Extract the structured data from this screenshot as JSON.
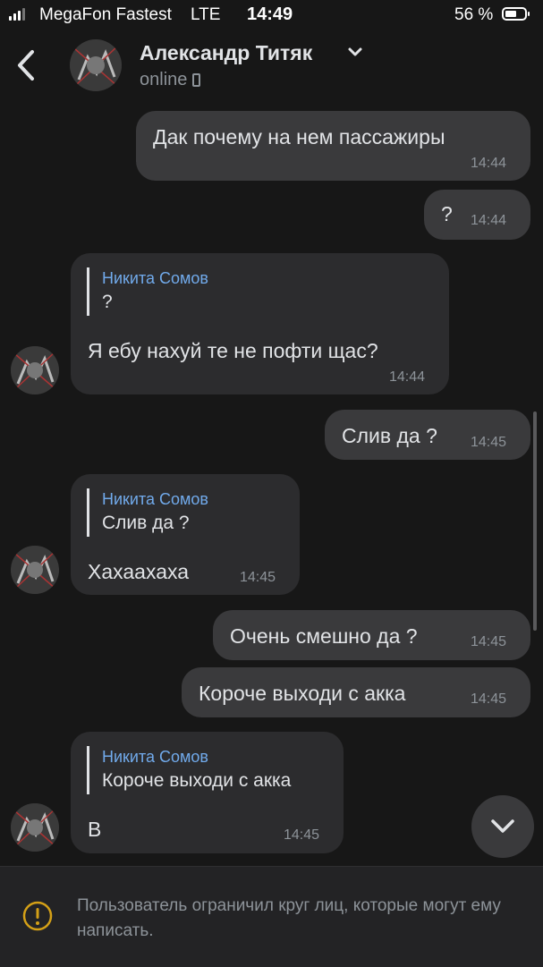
{
  "status_bar": {
    "carrier": "MegaFon Fastest",
    "network": "LTE",
    "time": "14:49",
    "battery": "56 %"
  },
  "header": {
    "name": "Александр Титяк",
    "status": "online"
  },
  "messages": [
    {
      "direction": "out",
      "text": "Дак почему на нем пассажиры",
      "time": "14:44"
    },
    {
      "direction": "out",
      "text": "?",
      "time": "14:44"
    },
    {
      "direction": "in",
      "reply_author": "Никита Сомов",
      "reply_text": "?",
      "text": "Я ебу нахуй те не пофти щас?",
      "time": "14:44"
    },
    {
      "direction": "out",
      "text": "Слив да ?",
      "time": "14:45"
    },
    {
      "direction": "in",
      "reply_author": "Никита Сомов",
      "reply_text": "Слив да ?",
      "text": "Хахаахаха",
      "time": "14:45"
    },
    {
      "direction": "out",
      "text": "Очень смешно да ?",
      "time": "14:45"
    },
    {
      "direction": "out",
      "text": "Короче выходи с акка",
      "time": "14:45"
    },
    {
      "direction": "in",
      "reply_author": "Никита Сомов",
      "reply_text": "Короче выходи с акка",
      "text": "В",
      "time": "14:45"
    }
  ],
  "footer": {
    "notice": "Пользователь ограничил круг лиц, которые могут ему написать."
  },
  "icons": {
    "back": "chevron-left-icon",
    "name_dropdown": "chevron-down-icon",
    "device": "phone-icon",
    "scroll_down": "chevron-down-icon",
    "warning": "exclamation-circle-icon"
  },
  "colors": {
    "background": "#171717",
    "outgoing_bubble": "#3a3a3c",
    "incoming_bubble": "#2c2c2e",
    "reply_author": "#71aaeb",
    "warning": "#d4a017"
  }
}
